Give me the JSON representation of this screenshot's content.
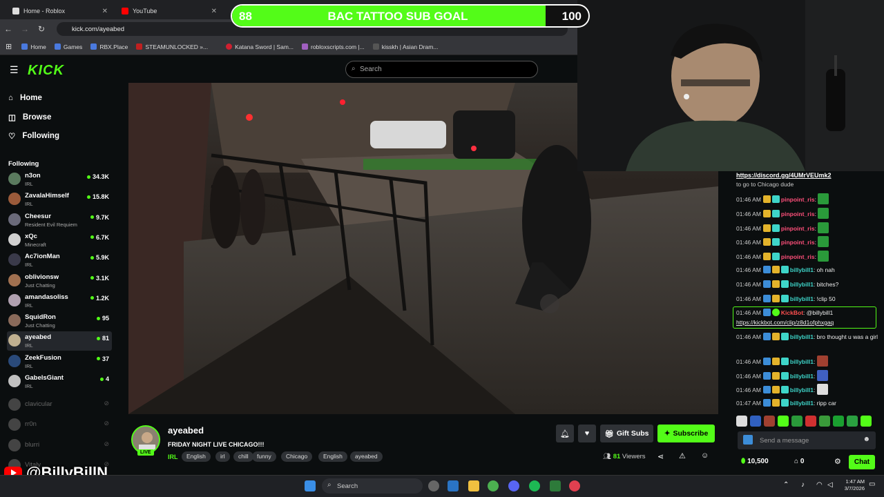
{
  "browser": {
    "tabs": [
      {
        "title": "Home - Roblox"
      },
      {
        "title": "YouTube"
      }
    ],
    "url": "kick.com/ayeabed",
    "bookmarks": [
      "Home",
      "Games",
      "RBX.Place",
      "STEAMUNLOCKED »...",
      "Katana Sword | Sam...",
      "robloxscripts.com |...",
      "kisskh | Asian Dram..."
    ]
  },
  "goal": {
    "label": "BAC TATTOO SUB GOAL",
    "current": "88",
    "target": "100",
    "progress": 0.88
  },
  "kick": {
    "logo": "KICK",
    "search_placeholder": "Search",
    "nav": {
      "home": "Home",
      "browse": "Browse",
      "following": "Following"
    },
    "following_heading": "Following",
    "following": [
      {
        "name": "n3on",
        "category": "IRL",
        "viewers": "34.3K",
        "color": "#5a7a5e"
      },
      {
        "name": "ZavalaHimself",
        "category": "IRL",
        "viewers": "15.8K",
        "color": "#9a5a3a"
      },
      {
        "name": "Cheesur",
        "category": "Resident Evil Requiem",
        "viewers": "9.7K",
        "color": "#6a6a7a"
      },
      {
        "name": "xQc",
        "category": "Minecraft",
        "viewers": "6.7K",
        "color": "#d0d0d0"
      },
      {
        "name": "Ac7ionMan",
        "category": "IRL",
        "viewers": "5.9K",
        "color": "#3a3a4a"
      },
      {
        "name": "oblivionsw",
        "category": "Just Chatting",
        "viewers": "3.1K",
        "color": "#a07050"
      },
      {
        "name": "amandasoliss",
        "category": "IRL",
        "viewers": "1.2K",
        "color": "#b0a0b0"
      },
      {
        "name": "SquidRon",
        "category": "Just Chatting",
        "viewers": "95",
        "color": "#8a6a5a"
      },
      {
        "name": "ayeabed",
        "category": "IRL",
        "viewers": "81",
        "color": "#c0b090"
      },
      {
        "name": "ZeekFusion",
        "category": "IRL",
        "viewers": "37",
        "color": "#2a4a7a"
      },
      {
        "name": "GabelsGiant",
        "category": "IRL",
        "viewers": "4",
        "color": "#c0c0c0"
      }
    ],
    "offline": [
      "clavicular",
      "rr0n",
      "blurri",
      "Vitaly"
    ]
  },
  "stream": {
    "streamer": "ayeabed",
    "live_badge": "LIVE",
    "title": "FRIDAY NIGHT LIVE CHICAGO!!!",
    "category": "IRL",
    "tags": [
      "English",
      "irl",
      "chill",
      "funny",
      "Chicago",
      "English",
      "ayeabed"
    ],
    "gift_label": "Gift Subs",
    "subscribe_label": "Subscribe",
    "viewers": "81",
    "viewers_label": "Viewers"
  },
  "chat": {
    "pinned_link": "https://discord.gg/4UMrVEUmk2",
    "overflow_text": "to go to Chicago dude",
    "messages": [
      {
        "time": "01:46 AM",
        "user": "pinpoint_ris",
        "text": "",
        "color": "#ff4f7a",
        "emote": true
      },
      {
        "time": "01:46 AM",
        "user": "pinpoint_ris",
        "text": "",
        "color": "#ff4f7a",
        "emote": true
      },
      {
        "time": "01:46 AM",
        "user": "pinpoint_ris",
        "text": "",
        "color": "#ff4f7a",
        "emote": true
      },
      {
        "time": "01:46 AM",
        "user": "pinpoint_ris",
        "text": "",
        "color": "#ff4f7a",
        "emote": true
      },
      {
        "time": "01:46 AM",
        "user": "pinpoint_ris",
        "text": "",
        "color": "#ff4f7a",
        "emote": true
      },
      {
        "time": "01:46 AM",
        "user": "billybill1",
        "text": "oh nah",
        "color": "#3ed5c9",
        "emote": false
      },
      {
        "time": "01:46 AM",
        "user": "billybill1",
        "text": "bitches?",
        "color": "#3ed5c9",
        "emote": false
      },
      {
        "time": "01:46 AM",
        "user": "billybill1",
        "text": "!clip 50",
        "color": "#3ed5c9",
        "emote": false
      }
    ],
    "kickbot": {
      "time": "01:46 AM",
      "user": "KickBot",
      "mention": "@billybill1",
      "link": "https://kickbot.com/clip/z8d1ofphxgaq"
    },
    "after": [
      {
        "time": "01:46 AM",
        "user": "billybill1",
        "text": "bro thought u was a girl"
      },
      {
        "time": "01:46 AM",
        "user": "billybill1",
        "text": ""
      },
      {
        "time": "01:46 AM",
        "user": "billybill1",
        "text": ""
      },
      {
        "time": "01:46 AM",
        "user": "billybill1",
        "text": ""
      },
      {
        "time": "01:47 AM",
        "user": "billybill1",
        "text": "ripp car"
      }
    ],
    "input_placeholder": "Send a message",
    "points": "10,500",
    "count": "0",
    "send_label": "Chat"
  },
  "watermark": "@BillyBillN",
  "taskbar": {
    "search": "Search",
    "time": "1:47 AM",
    "date": "3/7/2026"
  }
}
